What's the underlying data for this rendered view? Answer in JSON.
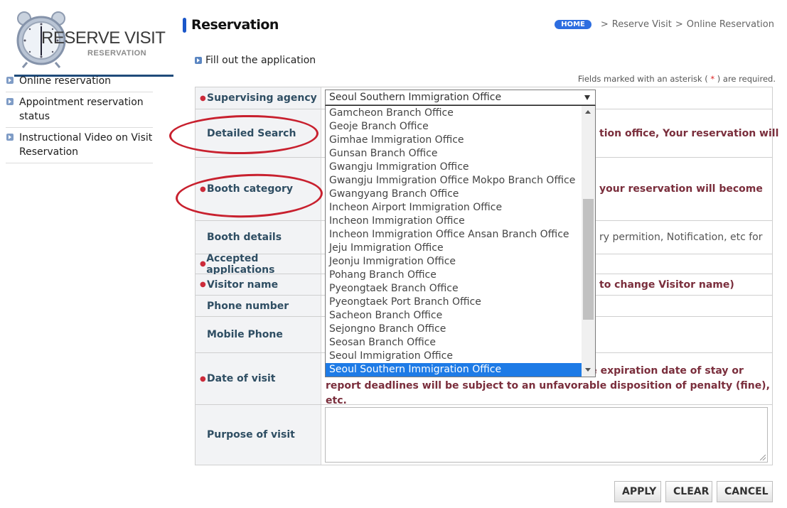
{
  "logo": {
    "title": "RESERVE VISIT",
    "subtitle": "RESERVATION"
  },
  "sidebar": {
    "items": [
      {
        "label": "Online reservation"
      },
      {
        "label": "Appointment reservation status"
      },
      {
        "label": "Instructional Video on Visit Reservation"
      }
    ]
  },
  "header": {
    "title": "Reservation",
    "breadcrumb": {
      "home": "HOME",
      "items": [
        "Reserve Visit",
        "Online Reservation"
      ],
      "separator": ">"
    }
  },
  "section": {
    "title": "Fill out the application",
    "required_note_prefix": "Fields marked with an asterisk (",
    "required_note_star": "*",
    "required_note_suffix": ") are required."
  },
  "form": {
    "rows": [
      {
        "label": "Supervising agency",
        "required": true,
        "value": ""
      },
      {
        "label": "Detailed Search",
        "required": false,
        "value": "tion office, Your reservation will"
      },
      {
        "label": "Booth category",
        "required": true,
        "value": "your reservation will become"
      },
      {
        "label": "Booth details",
        "required": false,
        "value": "ry permition, Notification, etc for"
      },
      {
        "label": "Accepted applications",
        "required": true,
        "value": ""
      },
      {
        "label": "Visitor name",
        "required": true,
        "value": "to change Visitor name)"
      },
      {
        "label": "Phone number",
        "required": false,
        "value": ""
      },
      {
        "label": "Mobile Phone",
        "required": false,
        "value": ""
      },
      {
        "label": "Date of visit",
        "required": true,
        "value": "It should be noted that those who visit after the expiration date of stay or report deadlines will be subject to an unfavorable disposition of penalty (fine), etc."
      },
      {
        "label": "Purpose of visit",
        "required": false,
        "value": ""
      }
    ],
    "purpose_value": ""
  },
  "agency_select": {
    "selected": "Seoul Southern Immigration Office",
    "options_visible": [
      "Gamcheon Branch Office",
      "Geoje Branch Office",
      "Gimhae Immigration Office",
      "Gunsan Branch Office",
      "Gwangju Immigration Office",
      "Gwangju Immigration Office Mokpo Branch Office",
      "Gwangyang Branch Office",
      "Incheon Airport Immigration Office",
      "Incheon Immigration Office",
      "Incheon Immigration Office Ansan Branch Office",
      "Jeju Immigration Office",
      "Jeonju Immigration Office",
      "Pohang Branch Office",
      "Pyeongtaek Branch Office",
      "Pyeongtaek Port Branch Office",
      "Sacheon Branch Office",
      "Sejongno Branch Office",
      "Seosan Branch Office",
      "Seoul Immigration Office",
      "Seoul Southern Immigration Office"
    ],
    "highlighted_index": 19
  },
  "buttons": {
    "apply": "APPLY",
    "clear": "CLEAR",
    "cancel": "CANCEL"
  },
  "colors": {
    "accent": "#1b57c9",
    "home_badge": "#2d6de0",
    "label_text": "#2f4e63",
    "warning_text": "#7a2e3c",
    "required_star": "#cc2b3a",
    "selection": "#1e7be6",
    "annotation": "#c8202e"
  }
}
